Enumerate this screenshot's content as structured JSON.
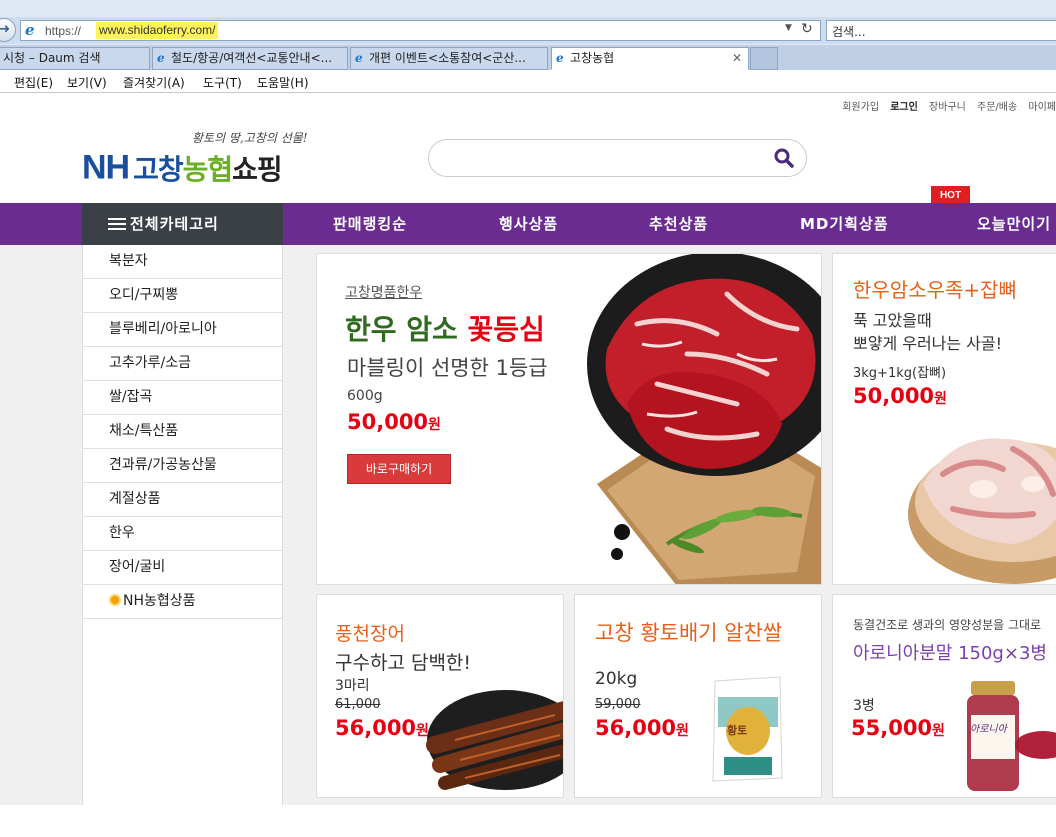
{
  "browser": {
    "address_prefix": "https://",
    "address_host": "www.shidaoferry.com/",
    "search_placeholder": "검색...",
    "tabs": [
      {
        "label": "시청 – Daum 검색"
      },
      {
        "label": "철도/항공/여객선<교통안내<..."
      },
      {
        "label": "개편 이벤트<소통참여<군산..."
      },
      {
        "label": "고창농협"
      }
    ],
    "menu": [
      "편집(E)",
      "보기(V)",
      "즐겨찾기(A)",
      "도구(T)",
      "도움말(H)"
    ]
  },
  "topnav": [
    "회원가입",
    "로그인",
    "장바구니",
    "주문/배송",
    "마이페"
  ],
  "header": {
    "tagline": "황토의 땅,고창의 선물!",
    "logo_nh": "NH",
    "logo_a": "고창",
    "logo_b": "농협",
    "logo_c": "쇼핑"
  },
  "gnb": {
    "all_category": "전체카테고리",
    "items": [
      "판매랭킹순",
      "행사상품",
      "추천상품",
      "MD기획상품",
      "오늘만이기"
    ],
    "hot_badge": "HOT"
  },
  "categories": [
    "복분자",
    "오디/구찌뽕",
    "블루베리/아로니아",
    "고추가루/소금",
    "쌀/잡곡",
    "채소/특산품",
    "견과류/가공농산물",
    "계절상품",
    "한우",
    "장어/굴비",
    "NH농협상품"
  ],
  "products": {
    "main": {
      "tag": "고창명품한우",
      "title_a": "한우 암소 ",
      "title_b": "꽃등심",
      "subtitle": "마블링이 선명한 1등급",
      "weight": "600g",
      "price": "50,000",
      "won": "원",
      "button": "바로구매하기"
    },
    "side": {
      "title": "한우암소우족+잡뼈",
      "desc1": "푹 고았을때",
      "desc2": "뽀얗게 우러나는 사골!",
      "weight": "3kg+1kg(잡뼈)",
      "price": "50,000",
      "won": "원"
    },
    "eel": {
      "title": "풍천장어",
      "desc": "구수하고 담백한!",
      "qty": "3마리",
      "old_price": "61,000",
      "price": "56,000",
      "won": "원"
    },
    "rice": {
      "title": "고창 황토배기 알찬쌀",
      "weight": "20kg",
      "old_price": "59,000",
      "price": "56,000",
      "won": "원",
      "bag_label": "황토"
    },
    "aronia": {
      "desc": "동결건조로 생과의 영양성분을 그대로",
      "title": "아로니아분말 150g×3병",
      "qty": "3병",
      "price": "55,000",
      "won": "원",
      "jar_label": "아로니아"
    }
  },
  "colors": {
    "gnb_purple": "#6b2c91",
    "all_category_bg": "#3b3f46",
    "price_red": "#e60012",
    "title_orange": "#e8611a",
    "title_green": "#2f6b1e",
    "aronia_purple": "#7b3fb0"
  }
}
